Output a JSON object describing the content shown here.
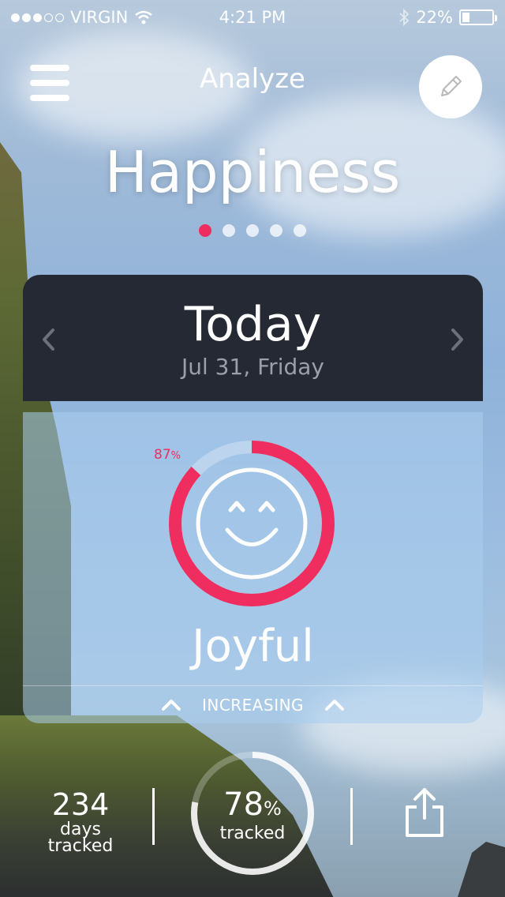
{
  "status_bar": {
    "carrier": "VIRGIN",
    "time": "4:21 PM",
    "battery_percent": "22%",
    "battery_level": 0.22,
    "signal_bars": 3,
    "signal_total": 5
  },
  "header": {
    "title": "Analyze",
    "menu_icon": "hamburger-menu-icon",
    "edit_icon": "pencil-icon"
  },
  "page": {
    "title": "Happiness",
    "pager_count": 5,
    "pager_active_index": 0
  },
  "date_card": {
    "day": "Today",
    "date": "Jul 31, Friday"
  },
  "mood": {
    "percent": "87",
    "percent_unit": "%",
    "percent_value": 87,
    "face_icon": "smiley-face-icon",
    "label": "Joyful",
    "trend": "INCREASING"
  },
  "stats": {
    "days_count": "234",
    "days_label_1": "days",
    "days_label_2": "tracked",
    "tracked_percent": "78",
    "tracked_unit": "%",
    "tracked_label": "tracked",
    "tracked_value": 78,
    "share_icon": "share-icon"
  },
  "colors": {
    "accent": "#ef2d5e",
    "card_dark": "#242933",
    "date_sub": "#9a9fa8"
  }
}
